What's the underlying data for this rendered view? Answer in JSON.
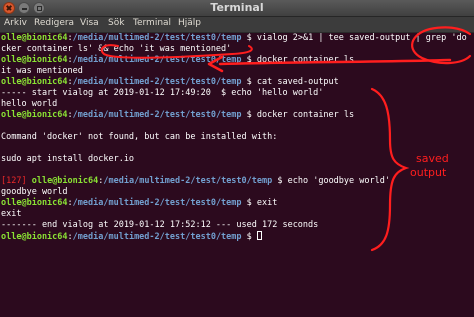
{
  "window": {
    "title": "Terminal"
  },
  "menu": [
    "Arkiv",
    "Redigera",
    "Visa",
    "Sök",
    "Terminal",
    "Hjälp"
  ],
  "prompt": {
    "user_host": "olle@bionic64",
    "sep": ":",
    "path": "/media/multimed-2/test/test0/temp",
    "symbol": " $ "
  },
  "lines": {
    "l1_cmd": "vialog 2>&1 | tee saved-output | grep 'do",
    "l2": "cker container ls' && echo 'it was mentioned'",
    "l3_cmd": "docker container ls",
    "l4": "it was mentioned",
    "l5_cmd": "cat saved-output",
    "l6": "----- start vialog at 2019-01-12 17:49:20 ",
    "l6_cmd": "echo 'hello world'",
    "l7": "hello world",
    "l8_cmd": "docker container ls",
    "l10": "Command 'docker' not found, but can be installed with:",
    "l12": "sudo apt install docker.io",
    "l14_status": "[127] ",
    "l14_cmd": "echo 'goodbye world'",
    "l15": "goodbye world",
    "l16_cmd": "exit",
    "l17": "exit",
    "l18": "------- end vialog at 2019-01-12 17:52:12 --- used 172 seconds"
  },
  "annotation": {
    "label_line1": "saved",
    "label_line2": "output",
    "color": "#ff1e1e"
  },
  "colors": {
    "terminal_bg": "#2c0a1e",
    "prompt_user": "#8ae234",
    "prompt_path": "#729fcf",
    "error_status": "#ef2929"
  }
}
